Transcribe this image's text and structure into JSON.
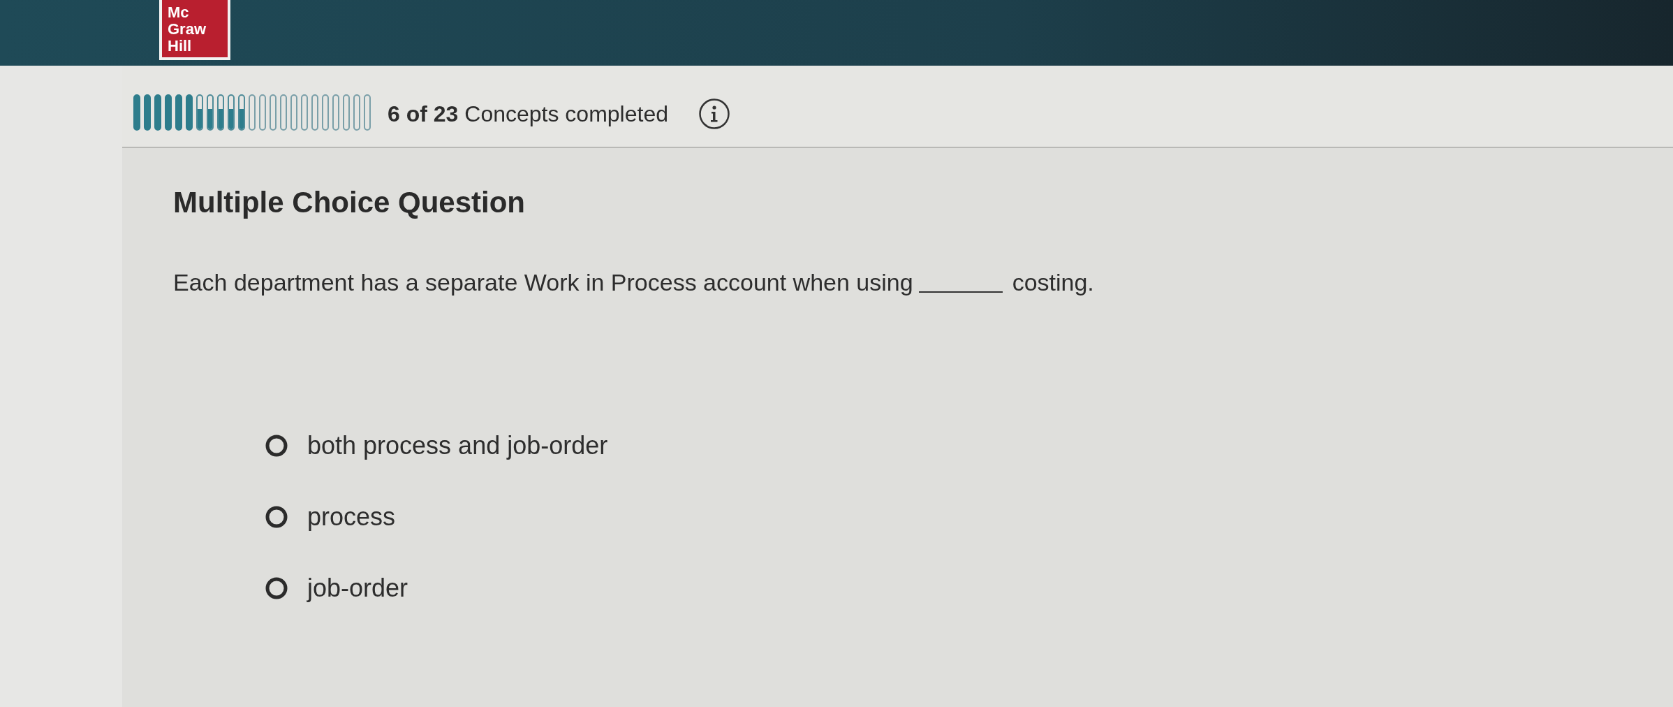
{
  "header": {
    "logo": {
      "lines": [
        "Mc",
        "Graw",
        "Hill"
      ]
    }
  },
  "progress": {
    "segments": [
      {
        "kind": "filled"
      },
      {
        "kind": "filled"
      },
      {
        "kind": "filled"
      },
      {
        "kind": "filled"
      },
      {
        "kind": "filled"
      },
      {
        "kind": "filled"
      },
      {
        "kind": "partial",
        "level": 0.6
      },
      {
        "kind": "partial",
        "level": 0.6
      },
      {
        "kind": "partial",
        "level": 0.6
      },
      {
        "kind": "partial",
        "level": 0.6
      },
      {
        "kind": "partial",
        "level": 0.6
      },
      {
        "kind": "empty"
      },
      {
        "kind": "empty"
      },
      {
        "kind": "empty"
      },
      {
        "kind": "empty"
      },
      {
        "kind": "empty"
      },
      {
        "kind": "empty"
      },
      {
        "kind": "empty"
      },
      {
        "kind": "empty"
      },
      {
        "kind": "empty"
      },
      {
        "kind": "empty"
      },
      {
        "kind": "empty"
      },
      {
        "kind": "empty"
      }
    ],
    "status": "**6 of 23** Concepts completed"
  },
  "question": {
    "heading": "Multiple Choice Question",
    "before_blank": "Each department has a separate Work in Process account when using",
    "after_blank": "costing."
  },
  "options": [
    {
      "label": "both process and job-order",
      "selected": false
    },
    {
      "label": "process",
      "selected": false
    },
    {
      "label": "job-order",
      "selected": false
    }
  ]
}
